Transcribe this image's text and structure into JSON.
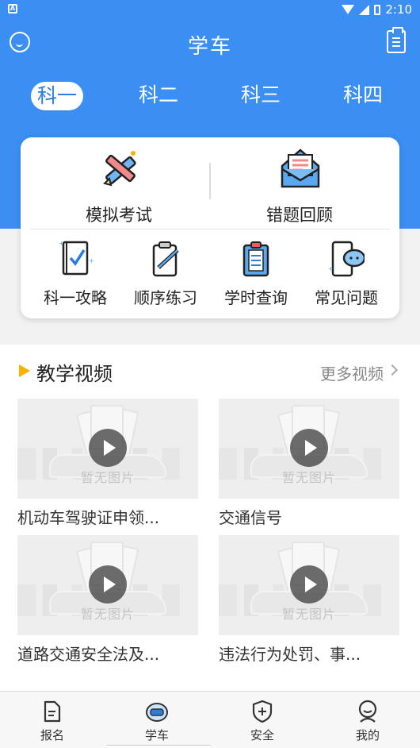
{
  "status_bar": {
    "time": "2:10",
    "left_badge": "A"
  },
  "header": {
    "title": "学车"
  },
  "tabs": [
    {
      "label": "科一",
      "active": true
    },
    {
      "label": "科二",
      "active": false
    },
    {
      "label": "科三",
      "active": false
    },
    {
      "label": "科四",
      "active": false
    }
  ],
  "card": {
    "primary": [
      {
        "label": "模拟考试",
        "icon": "pencil-ruler-icon"
      },
      {
        "label": "错题回顾",
        "icon": "envelope-icon"
      }
    ],
    "secondary": [
      {
        "label": "科一攻略",
        "icon": "book-check-icon"
      },
      {
        "label": "顺序练习",
        "icon": "clipboard-pen-icon"
      },
      {
        "label": "学时查询",
        "icon": "clipboard-list-icon"
      },
      {
        "label": "常见问题",
        "icon": "phone-chat-icon"
      }
    ]
  },
  "videos": {
    "section_title": "教学视频",
    "more_label": "更多视频",
    "placeholder_text": "暂无图片",
    "items": [
      {
        "title": "机动车驾驶证申领..."
      },
      {
        "title": "交通信号"
      },
      {
        "title": "道路交通安全法及..."
      },
      {
        "title": "违法行为处罚、事..."
      }
    ]
  },
  "bottom_nav": [
    {
      "label": "报名",
      "icon": "document-icon",
      "active": false
    },
    {
      "label": "学车",
      "icon": "car-icon",
      "active": true
    },
    {
      "label": "安全",
      "icon": "shield-plus-icon",
      "active": false
    },
    {
      "label": "我的",
      "icon": "person-icon",
      "active": false
    }
  ],
  "colors": {
    "primary": "#3b8ff2",
    "accent": "#f6b400"
  }
}
